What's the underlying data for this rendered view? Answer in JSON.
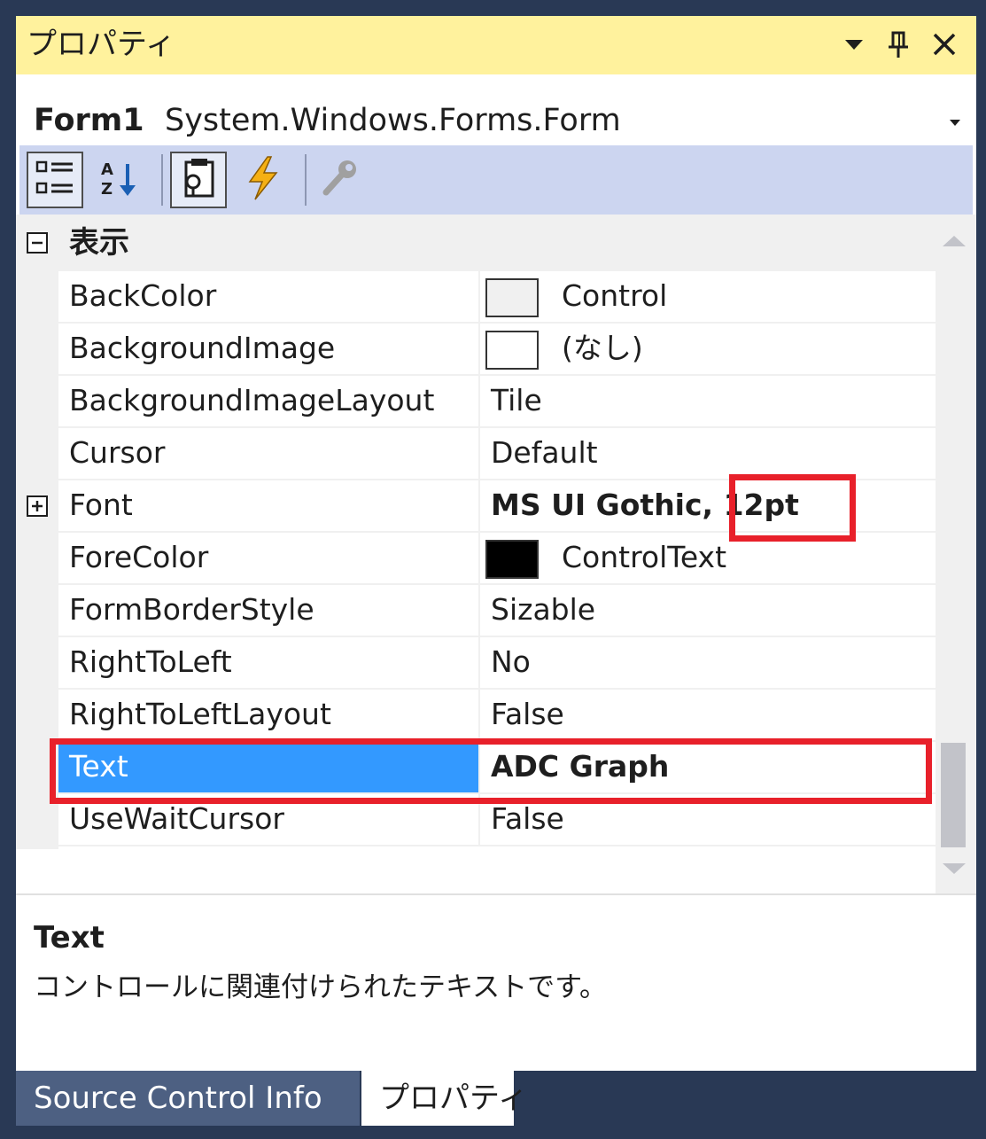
{
  "window": {
    "title": "プロパティ",
    "icons": [
      "dropdown-arrow-icon",
      "pin-icon",
      "close-icon"
    ]
  },
  "object_selector": {
    "name": "Form1",
    "type": "System.Windows.Forms.Form"
  },
  "toolbar": {
    "buttons": [
      "categorized-icon",
      "alphabetical-icon",
      "properties-icon",
      "events-icon",
      "property-pages-icon"
    ]
  },
  "category": {
    "label": "表示",
    "toggle": "⊟"
  },
  "properties": [
    {
      "name": "BackColor",
      "value": "Control",
      "swatch": "#f0f0f0"
    },
    {
      "name": "BackgroundImage",
      "value": "(なし)",
      "swatch": "#ffffff"
    },
    {
      "name": "BackgroundImageLayout",
      "value": "Tile"
    },
    {
      "name": "Cursor",
      "value": "Default"
    },
    {
      "name": "Font",
      "value": "MS UI Gothic, 12pt",
      "bold": true,
      "expandable": true
    },
    {
      "name": "ForeColor",
      "value": "ControlText",
      "swatch": "#000000"
    },
    {
      "name": "FormBorderStyle",
      "value": "Sizable"
    },
    {
      "name": "RightToLeft",
      "value": "No"
    },
    {
      "name": "RightToLeftLayout",
      "value": "False"
    },
    {
      "name": "Text",
      "value": "ADC Graph",
      "bold": true,
      "selected": true
    },
    {
      "name": "UseWaitCursor",
      "value": "False"
    }
  ],
  "description": {
    "title": "Text",
    "body": "コントロールに関連付けられたテキストです。"
  },
  "tabs": [
    {
      "label": "Source Control Info",
      "active": false
    },
    {
      "label": "プロパティ",
      "active": true
    }
  ],
  "colors": {
    "titlebar": "#fff29d",
    "toolbar": "#ccd5f0",
    "selection": "#3399ff",
    "highlight": "#e8202a",
    "frame": "#293955"
  }
}
